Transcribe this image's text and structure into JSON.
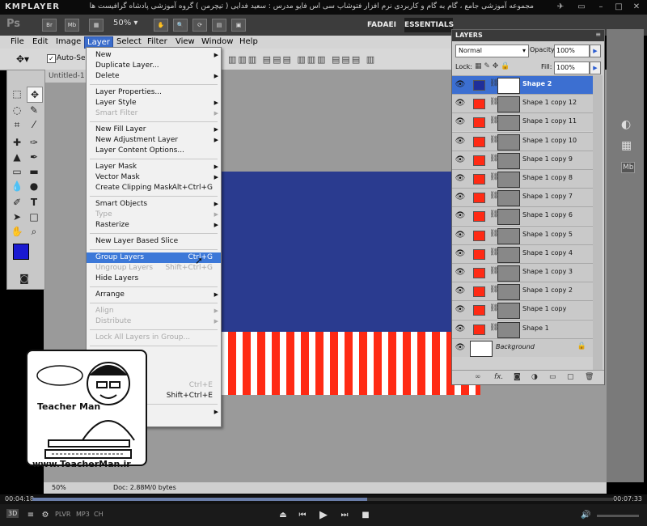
{
  "kmplayer": {
    "logo": "KMPLAYER",
    "caption": "مجموعه آموزشی جامع ، گام به گام و کاربردی نرم افزار فتوشاپ سی اس فایو  مدرس : سعید فدایی ( تیچرمن ) گروه آموزشی پادشاه گرافیست ها",
    "elapsed": "00:04:18",
    "total": "00:07:33",
    "badges": [
      "3D",
      "PLVR",
      "MP3",
      "CH"
    ]
  },
  "ps": {
    "logo": "Ps",
    "app_icons": [
      "Br",
      "Mb"
    ],
    "zoom": "50%",
    "workspaces": [
      "FADAEI",
      "ESSENTIALS"
    ],
    "menu": [
      "File",
      "Edit",
      "Image",
      "Layer",
      "Select",
      "Filter",
      "View",
      "Window",
      "Help"
    ],
    "options_auto_select": "Auto-Select",
    "doc_tab": "Untitled-1",
    "status": {
      "zoom": "50%",
      "doc": "Doc: 2.88M/0 bytes"
    }
  },
  "layer_menu": [
    {
      "label": "New",
      "arrow": true
    },
    {
      "label": "Duplicate Layer..."
    },
    {
      "label": "Delete",
      "arrow": true
    },
    {
      "sep": true
    },
    {
      "label": "Layer Properties..."
    },
    {
      "label": "Layer Style",
      "arrow": true
    },
    {
      "label": "Smart Filter",
      "disabled": true,
      "arrow": true
    },
    {
      "sep": true
    },
    {
      "label": "New Fill Layer",
      "arrow": true
    },
    {
      "label": "New Adjustment Layer",
      "arrow": true
    },
    {
      "label": "Layer Content Options..."
    },
    {
      "sep": true
    },
    {
      "label": "Layer Mask",
      "arrow": true
    },
    {
      "label": "Vector Mask",
      "arrow": true
    },
    {
      "label": "Create Clipping Mask",
      "shortcut": "Alt+Ctrl+G"
    },
    {
      "sep": true
    },
    {
      "label": "Smart Objects",
      "arrow": true
    },
    {
      "label": "Type",
      "disabled": true,
      "arrow": true
    },
    {
      "label": "Rasterize",
      "arrow": true
    },
    {
      "sep": true
    },
    {
      "label": "New Layer Based Slice"
    },
    {
      "sep": true
    },
    {
      "label": "Group Layers",
      "shortcut": "Ctrl+G",
      "highlight": true
    },
    {
      "label": "Ungroup Layers",
      "shortcut": "Shift+Ctrl+G",
      "disabled": true
    },
    {
      "label": "Hide Layers"
    },
    {
      "sep": true
    },
    {
      "label": "Arrange",
      "arrow": true
    },
    {
      "sep": true
    },
    {
      "label": "Align",
      "disabled": true,
      "arrow": true
    },
    {
      "label": "Distribute",
      "disabled": true,
      "arrow": true
    },
    {
      "sep": true
    },
    {
      "label": "Lock All Layers in Group...",
      "disabled": true
    },
    {
      "sep": true
    },
    {
      "label": ""
    },
    {
      "label": ""
    },
    {
      "label": ""
    },
    {
      "label": "",
      "shortcut": "Ctrl+E",
      "disabled": true
    },
    {
      "label": "",
      "shortcut": "Shift+Ctrl+E"
    },
    {
      "sep": true
    },
    {
      "label": "",
      "arrow": true
    }
  ],
  "layers_panel": {
    "title": "LAYERS",
    "blend_mode": "Normal",
    "opacity_label": "Opacity:",
    "opacity": "100%",
    "lock_label": "Lock:",
    "fill_label": "Fill:",
    "fill": "100%",
    "layers": [
      {
        "name": "Shape 2",
        "swatch": "#1f2f9a",
        "selected": true
      },
      {
        "name": "Shape 1 copy 12",
        "swatch": "#ff2a14"
      },
      {
        "name": "Shape 1 copy 11",
        "swatch": "#ff2a14"
      },
      {
        "name": "Shape 1 copy 10",
        "swatch": "#ff2a14"
      },
      {
        "name": "Shape 1 copy 9",
        "swatch": "#ff2a14"
      },
      {
        "name": "Shape 1 copy 8",
        "swatch": "#ff2a14"
      },
      {
        "name": "Shape 1 copy 7",
        "swatch": "#ff2a14"
      },
      {
        "name": "Shape 1 copy 6",
        "swatch": "#ff2a14"
      },
      {
        "name": "Shape 1 copy 5",
        "swatch": "#ff2a14"
      },
      {
        "name": "Shape 1 copy 4",
        "swatch": "#ff2a14"
      },
      {
        "name": "Shape 1 copy 3",
        "swatch": "#ff2a14"
      },
      {
        "name": "Shape 1 copy 2",
        "swatch": "#ff2a14"
      },
      {
        "name": "Shape 1 copy",
        "swatch": "#ff2a14"
      },
      {
        "name": "Shape 1",
        "swatch": "#ff2a14"
      },
      {
        "name": "Background",
        "background": true
      }
    ],
    "footer_icons": [
      "link-icon",
      "fx-icon",
      "mask-icon",
      "adjustment-icon",
      "folder-icon",
      "new-layer-icon",
      "trash-icon"
    ]
  },
  "teacher": {
    "logo_text": "Teacher Man",
    "url": "www.TeacherMan.ir"
  },
  "colors": {
    "foreground": "#1a1ad0",
    "background": "#ffffff",
    "canvas_blue": "#2a3b8f",
    "stripe_red": "#ff2a14",
    "highlight": "#3c78d8"
  }
}
